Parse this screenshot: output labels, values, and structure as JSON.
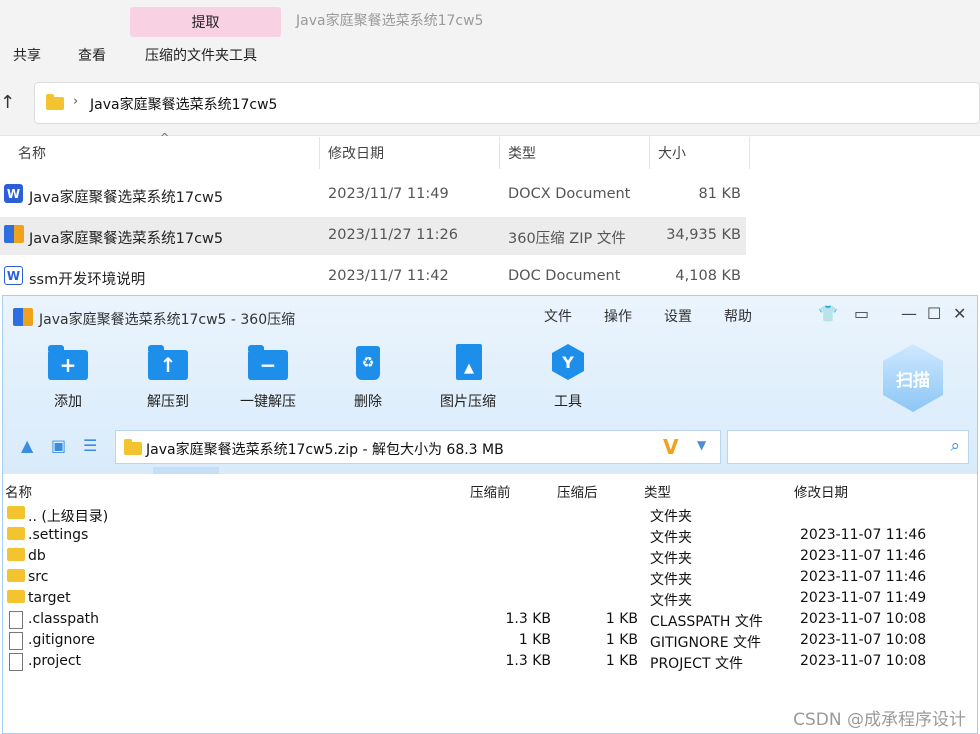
{
  "explorer": {
    "ribbon_tab_extract": "提取",
    "window_title": "Java家庭聚餐选菜系统17cw5",
    "menu": [
      "共享",
      "查看",
      "压缩的文件夹工具"
    ],
    "address_path": "Java家庭聚餐选菜系统17cw5",
    "columns": {
      "name": "名称",
      "date": "修改日期",
      "type": "类型",
      "size": "大小"
    },
    "files": [
      {
        "name": "Java家庭聚餐选菜系统17cw5",
        "date": "2023/11/7 11:49",
        "type": "DOCX Document",
        "size": "81 KB",
        "icon": "word-doc-icon"
      },
      {
        "name": "Java家庭聚餐选菜系统17cw5",
        "date": "2023/11/27 11:26",
        "type": "360压缩 ZIP 文件",
        "size": "34,935 KB",
        "icon": "zip-archive-icon"
      },
      {
        "name": "ssm开发环境说明",
        "date": "2023/11/7 11:42",
        "type": "DOC Document",
        "size": "4,108 KB",
        "icon": "word-doc-icon"
      }
    ]
  },
  "zip": {
    "title": "Java家庭聚餐选菜系统17cw5 - 360压缩",
    "menu": [
      "文件",
      "操作",
      "设置",
      "帮助"
    ],
    "tools": [
      "添加",
      "解压到",
      "一键解压",
      "删除",
      "图片压缩",
      "工具"
    ],
    "scan_label": "扫描",
    "path_text": "Java家庭聚餐选菜系统17cw5.zip - 解包大小为 68.3 MB",
    "columns": {
      "name": "名称",
      "before": "压缩前",
      "after": "压缩后",
      "type": "类型",
      "date": "修改日期"
    },
    "entries": [
      {
        "name": ".. (上级目录)",
        "before": "",
        "after": "",
        "type": "文件夹",
        "date": "",
        "kind": "folder"
      },
      {
        "name": ".settings",
        "before": "",
        "after": "",
        "type": "文件夹",
        "date": "2023-11-07 11:46",
        "kind": "folder"
      },
      {
        "name": "db",
        "before": "",
        "after": "",
        "type": "文件夹",
        "date": "2023-11-07 11:46",
        "kind": "folder"
      },
      {
        "name": "src",
        "before": "",
        "after": "",
        "type": "文件夹",
        "date": "2023-11-07 11:46",
        "kind": "folder"
      },
      {
        "name": "target",
        "before": "",
        "after": "",
        "type": "文件夹",
        "date": "2023-11-07 11:49",
        "kind": "folder"
      },
      {
        "name": ".classpath",
        "before": "1.3 KB",
        "after": "1 KB",
        "type": "CLASSPATH 文件",
        "date": "2023-11-07 10:08",
        "kind": "file"
      },
      {
        "name": ".gitignore",
        "before": "1 KB",
        "after": "1 KB",
        "type": "GITIGNORE 文件",
        "date": "2023-11-07 10:08",
        "kind": "file"
      },
      {
        "name": ".project",
        "before": "1.3 KB",
        "after": "1 KB",
        "type": "PROJECT 文件",
        "date": "2023-11-07 10:08",
        "kind": "file"
      }
    ]
  },
  "watermark": "CSDN @成承程序设计"
}
